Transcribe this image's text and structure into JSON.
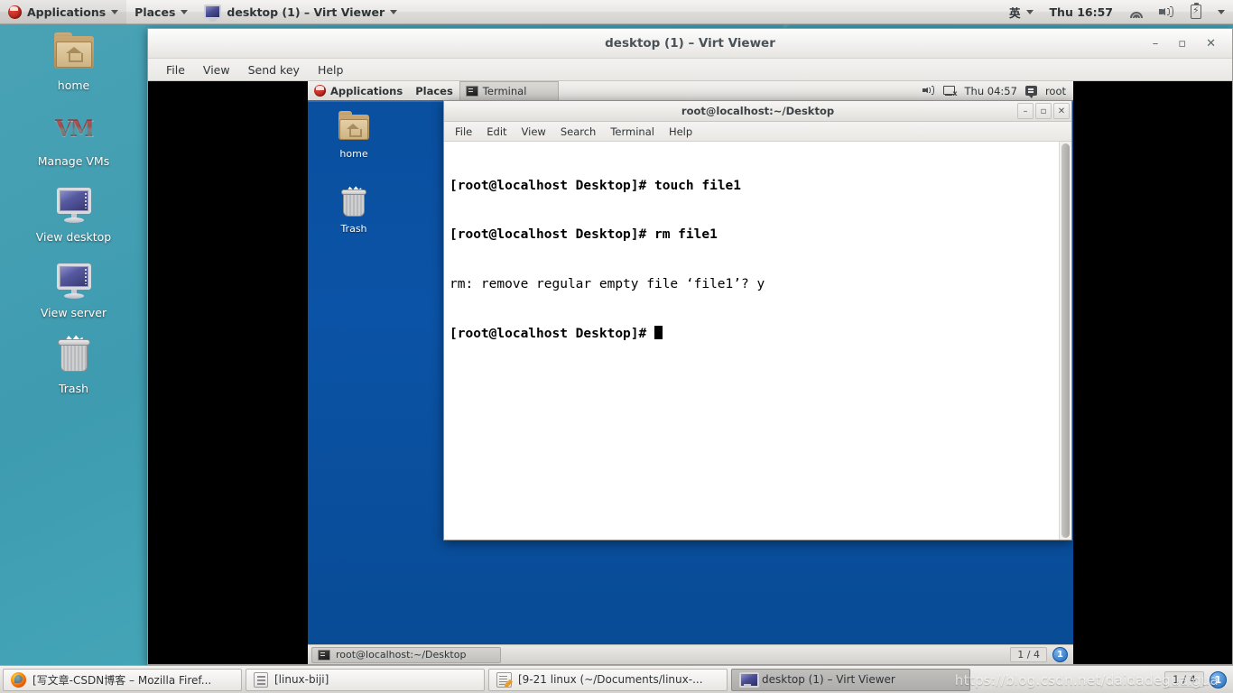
{
  "host": {
    "top_panel": {
      "applications_label": "Applications",
      "places_label": "Places",
      "window_button_label": "desktop (1) – Virt Viewer",
      "input_method_label": "英",
      "clock_label": "Thu 16:57",
      "icons": [
        "redhat-logo",
        "wifi-icon",
        "volume-icon",
        "battery-icon",
        "chevron-down-icon"
      ]
    },
    "desktop_icons": [
      {
        "label": "home",
        "icon": "home-folder-icon"
      },
      {
        "label": "Manage VMs",
        "icon": "virt-manager-icon",
        "glyph": "VM"
      },
      {
        "label": "View desktop",
        "icon": "monitor-icon"
      },
      {
        "label": "View server",
        "icon": "monitor-icon"
      },
      {
        "label": "Trash",
        "icon": "trash-icon"
      }
    ],
    "taskbar": {
      "buttons": [
        {
          "label": "[写文章-CSDN博客 – Mozilla Firef...",
          "icon": "firefox-icon",
          "active": false
        },
        {
          "label": "[linux-biji]",
          "icon": "archive-icon",
          "active": false
        },
        {
          "label": "[9-21 linux (~/Documents/linux-...",
          "icon": "gedit-icon",
          "active": false
        },
        {
          "label": "desktop (1) – Virt Viewer",
          "icon": "monitor-icon",
          "active": true
        }
      ],
      "workspace_label": "1 / 4",
      "workspace_badge": "1"
    },
    "watermark": "https://blog.csdn.net/daidadeguaigua"
  },
  "virt_viewer": {
    "title": "desktop (1) – Virt Viewer",
    "window_buttons": {
      "minimize": "–",
      "maximize": "▫",
      "close": "✕"
    },
    "menu": [
      "File",
      "View",
      "Send key",
      "Help"
    ]
  },
  "guest": {
    "top_panel": {
      "applications_label": "Applications",
      "places_label": "Places",
      "window_button_label": "Terminal",
      "clock_label": "Thu 04:57",
      "user_label": "root",
      "icons": [
        "redhat-logo",
        "volume-icon",
        "network-icon",
        "user-icon"
      ]
    },
    "desktop_icons": [
      {
        "label": "home",
        "icon": "home-folder-icon"
      },
      {
        "label": "Trash",
        "icon": "trash-icon"
      }
    ],
    "bottom_panel": {
      "task_label": "root@localhost:~/Desktop",
      "workspace_label": "1 / 4",
      "workspace_badge": "1"
    }
  },
  "terminal": {
    "title": "root@localhost:~/Desktop",
    "window_buttons": {
      "minimize": "–",
      "maximize": "▫",
      "close": "✕"
    },
    "menu": [
      "File",
      "Edit",
      "View",
      "Search",
      "Terminal",
      "Help"
    ],
    "lines": [
      {
        "prompt": "[root@localhost Desktop]#",
        "command": " touch file1",
        "bold_all": true
      },
      {
        "prompt": "[root@localhost Desktop]#",
        "command": " rm file1",
        "bold_all": true
      },
      {
        "prompt": "",
        "command": "rm: remove regular empty file ‘file1’? y",
        "bold_all": false
      },
      {
        "prompt": "[root@localhost Desktop]#",
        "command": " ",
        "bold_all": true,
        "cursor": true
      }
    ]
  },
  "colors": {
    "host_desktop": "#45a6b8",
    "guest_desktop": "#0b4f9e",
    "terminal_bg": "#ffffff",
    "terminal_fg": "#000000",
    "accent_blue": "#1d67b6"
  }
}
